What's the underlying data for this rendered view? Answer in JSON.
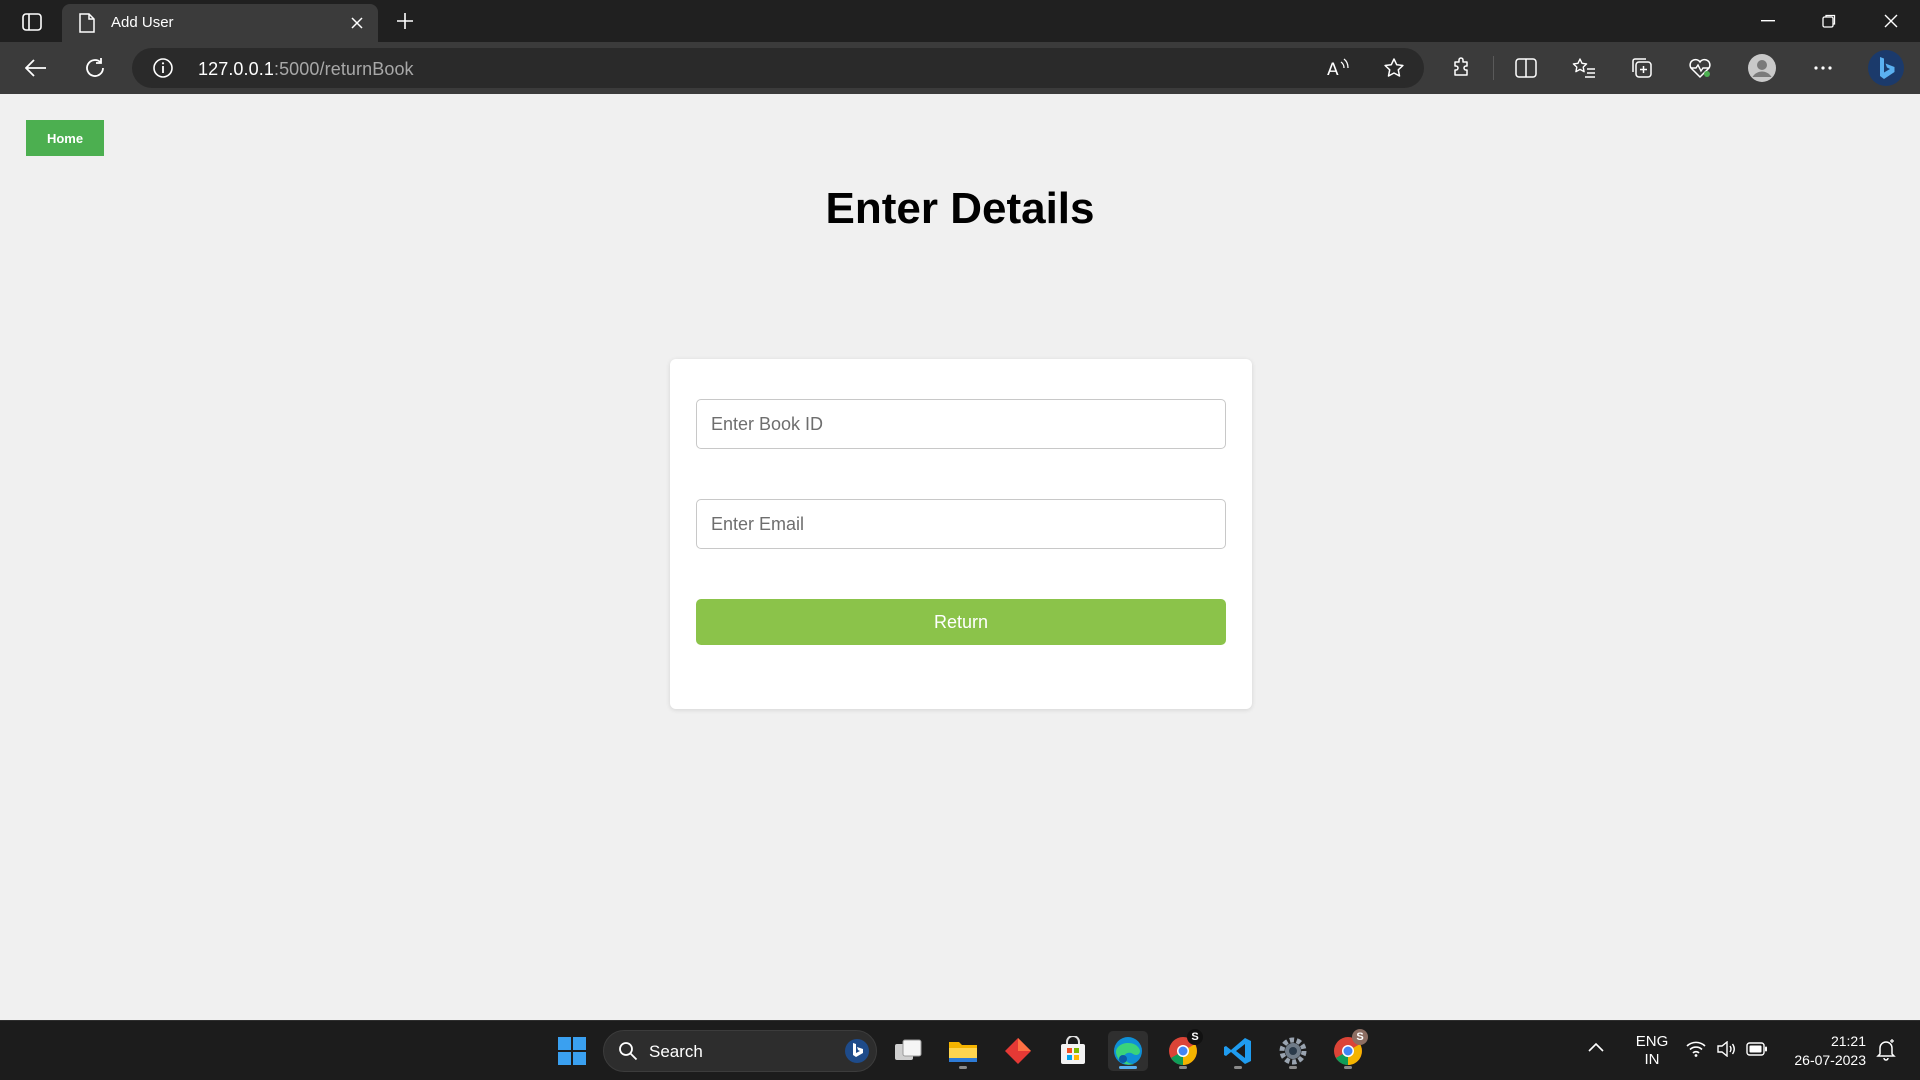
{
  "browser": {
    "tab_title": "Add User",
    "url_host": "127.0.0.1",
    "url_path": ":5000/returnBook"
  },
  "page": {
    "home_label": "Home",
    "title": "Enter Details",
    "form": {
      "book_id_placeholder": "Enter Book ID",
      "email_placeholder": "Enter Email",
      "submit_label": "Return"
    }
  },
  "taskbar": {
    "search_label": "Search",
    "lang_primary": "ENG",
    "lang_secondary": "IN",
    "time": "21:21",
    "date": "26-07-2023",
    "badge_chrome_1": "S",
    "badge_chrome_2": "S"
  },
  "colors": {
    "home_button": "#4caf50",
    "submit_button": "#8bc34a",
    "page_background": "#f0f0f0"
  }
}
